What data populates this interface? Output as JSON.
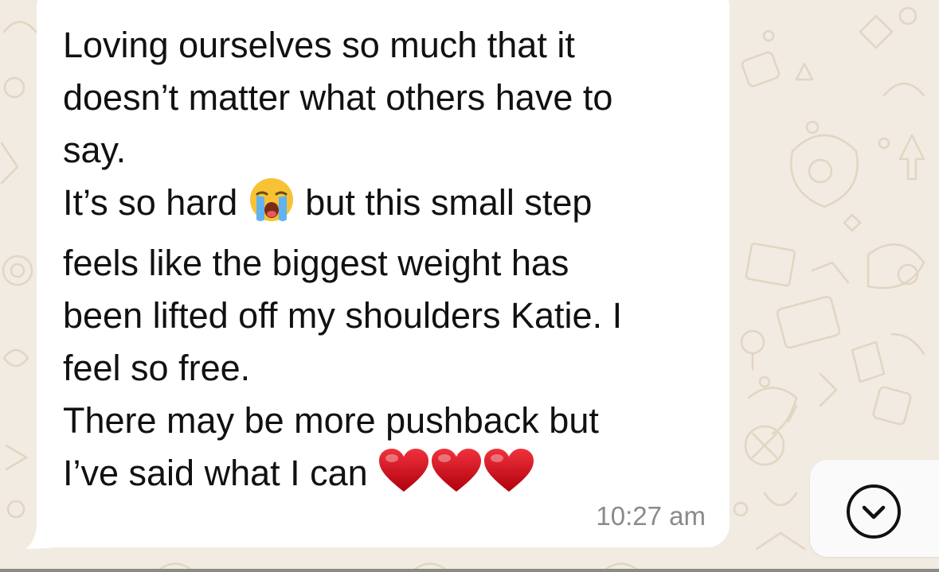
{
  "conversation": {
    "message": {
      "line1": "Loving ourselves so much that it",
      "line2": "doesn’t matter what others have to",
      "line3": "say.",
      "line4_before_emoji": "It’s so hard ",
      "line4_after_emoji": " but this small step",
      "line5": "feels like the biggest weight has",
      "line6": "been lifted off my shoulders Katie. I",
      "line7": "feel so free.",
      "line8": "There may be more pushback but",
      "line9": "I’ve said what I can ",
      "emoji_crying": "loudly-crying-face-icon",
      "emoji_hearts": [
        "red-heart-icon",
        "red-heart-icon",
        "red-heart-icon"
      ],
      "timestamp": "10:27 am"
    },
    "scroll_button": {
      "icon": "chevron-down-circle-icon"
    }
  },
  "colors": {
    "wallpaper": "#f1ebe1",
    "wallpaper_doodle": "#e4d8c6",
    "bubble": "#ffffff",
    "text": "#111111",
    "timestamp": "#8a8a8a",
    "heart": "#d3121f"
  }
}
